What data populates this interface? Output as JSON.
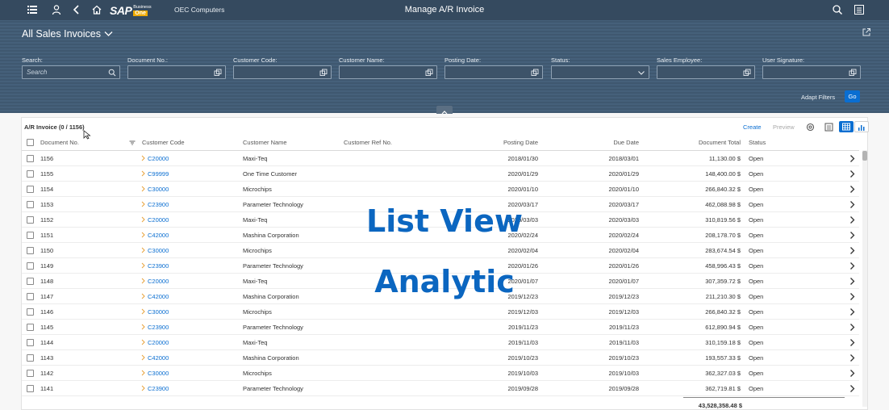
{
  "shell": {
    "company": "OEC Computers",
    "title": "Manage A/R Invoice",
    "logo_main": "SAP",
    "logo_business": "Business",
    "logo_one": "One"
  },
  "variant": {
    "label": "All Sales Invoices"
  },
  "filters": [
    {
      "label": "Search:",
      "placeholder": "Search",
      "icon": "search-icon"
    },
    {
      "label": "Document No.:",
      "placeholder": "",
      "icon": "value-help-icon"
    },
    {
      "label": "Customer Code:",
      "placeholder": "",
      "icon": "value-help-icon"
    },
    {
      "label": "Customer Name:",
      "placeholder": "",
      "icon": "value-help-icon"
    },
    {
      "label": "Posting Date:",
      "placeholder": "",
      "icon": "value-help-icon"
    },
    {
      "label": "Status:",
      "placeholder": "",
      "icon": "chevron-down-icon"
    },
    {
      "label": "Sales Employee:",
      "placeholder": "",
      "icon": "value-help-icon"
    },
    {
      "label": "User Signature:",
      "placeholder": "",
      "icon": "value-help-icon"
    }
  ],
  "filterbar": {
    "adapt": "Adapt Filters",
    "go": "Go"
  },
  "table": {
    "title": "A/R Invoice (0 / 1156)",
    "create": "Create",
    "preview": "Preview",
    "columns": [
      "Document No.",
      "Customer Code",
      "Customer Name",
      "Customer Ref No.",
      "Posting Date",
      "Due Date",
      "Document Total",
      "Status"
    ],
    "rows": [
      [
        "1156",
        "C20000",
        "Maxi-Teq",
        "",
        "2018/01/30",
        "2018/03/01",
        "11,130.00 $",
        "Open"
      ],
      [
        "1155",
        "C99999",
        "One Time Customer",
        "",
        "2020/01/29",
        "2020/01/29",
        "148,400.00 $",
        "Open"
      ],
      [
        "1154",
        "C30000",
        "Microchips",
        "",
        "2020/01/10",
        "2020/01/10",
        "266,840.32 $",
        "Open"
      ],
      [
        "1153",
        "C23900",
        "Parameter Technology",
        "",
        "2020/03/17",
        "2020/03/17",
        "462,088.98 $",
        "Open"
      ],
      [
        "1152",
        "C20000",
        "Maxi-Teq",
        "",
        "2020/03/03",
        "2020/03/03",
        "310,819.56 $",
        "Open"
      ],
      [
        "1151",
        "C42000",
        "Mashina Corporation",
        "",
        "2020/02/24",
        "2020/02/24",
        "208,178.70 $",
        "Open"
      ],
      [
        "1150",
        "C30000",
        "Microchips",
        "",
        "2020/02/04",
        "2020/02/04",
        "283,674.54 $",
        "Open"
      ],
      [
        "1149",
        "C23900",
        "Parameter Technology",
        "",
        "2020/01/26",
        "2020/01/26",
        "458,996.43 $",
        "Open"
      ],
      [
        "1148",
        "C20000",
        "Maxi-Teq",
        "",
        "2020/01/07",
        "2020/01/07",
        "307,359.72 $",
        "Open"
      ],
      [
        "1147",
        "C42000",
        "Mashina Corporation",
        "",
        "2019/12/23",
        "2019/12/23",
        "211,210.30 $",
        "Open"
      ],
      [
        "1146",
        "C30000",
        "Microchips",
        "",
        "2019/12/03",
        "2019/12/03",
        "266,840.32 $",
        "Open"
      ],
      [
        "1145",
        "C23900",
        "Parameter Technology",
        "",
        "2019/11/23",
        "2019/11/23",
        "612,890.94 $",
        "Open"
      ],
      [
        "1144",
        "C20000",
        "Maxi-Teq",
        "",
        "2019/11/03",
        "2019/11/03",
        "310,159.18 $",
        "Open"
      ],
      [
        "1143",
        "C42000",
        "Mashina Corporation",
        "",
        "2019/10/23",
        "2019/10/23",
        "193,557.33 $",
        "Open"
      ],
      [
        "1142",
        "C30000",
        "Microchips",
        "",
        "2019/10/03",
        "2019/10/03",
        "362,327.03 $",
        "Open"
      ],
      [
        "1141",
        "C23900",
        "Parameter Technology",
        "",
        "2019/09/28",
        "2019/09/28",
        "362,719.81 $",
        "Open"
      ]
    ],
    "total": "43,528,358.48 $"
  },
  "overlay": {
    "line1": "List View",
    "line2": "Analytic"
  },
  "colors": {
    "shell": "#354a5f",
    "header": "#3f5870",
    "accent": "#0a6ed1",
    "overlay": "#0b66c0"
  }
}
